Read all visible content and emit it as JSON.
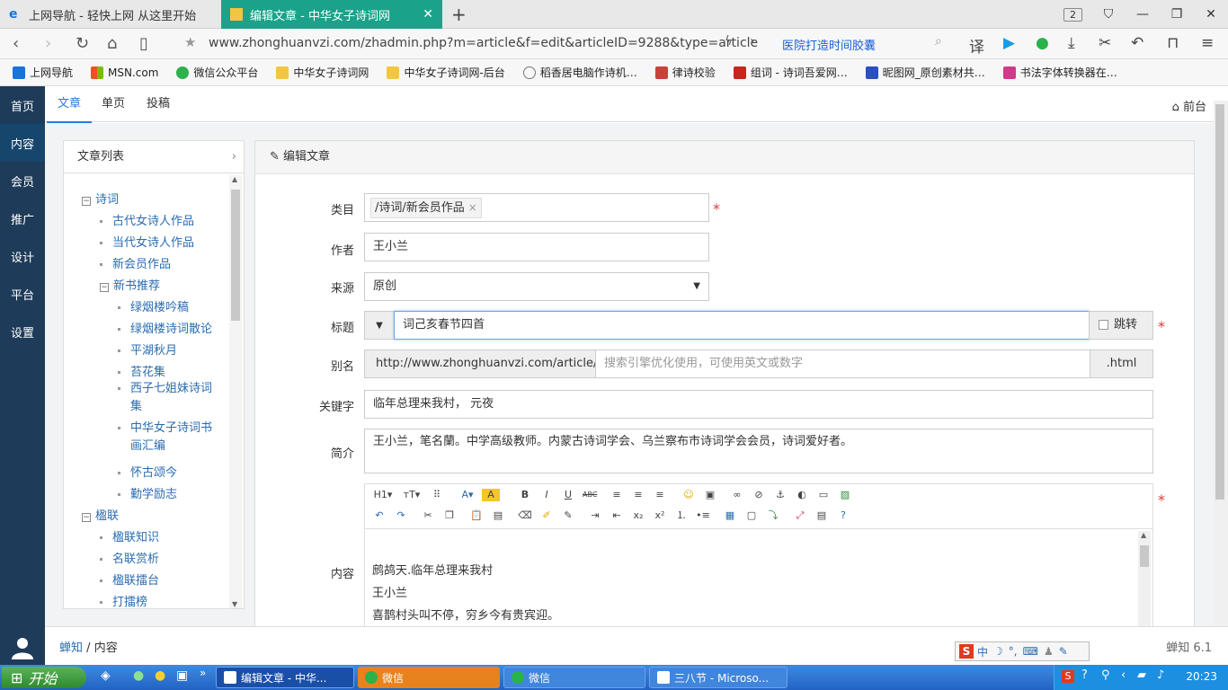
{
  "browser": {
    "tabs": [
      {
        "label": "上网导航 - 轻快上网 从这里开始",
        "active": false
      },
      {
        "label": "编辑文章 - 中华女子诗词网",
        "active": true
      }
    ],
    "tab_count": "2",
    "url": "www.zhonghuanvzi.com/zhadmin.php?m=article&f=edit&articleID=9288&type=article",
    "ad_text": "医院打造时间胶囊",
    "bookmarks": [
      "上网导航",
      "MSN.com",
      "微信公众平台",
      "中华女子诗词网",
      "中华女子诗词网-后台",
      "稻香居电脑作诗机…",
      "律诗校验",
      "组词 - 诗词吾爱网…",
      "昵图网_原创素材共…",
      "书法字体转换器在…"
    ]
  },
  "leftnav": [
    "首页",
    "内容",
    "会员",
    "推广",
    "设计",
    "平台",
    "设置"
  ],
  "topnav": {
    "items": [
      "文章",
      "单页",
      "投稿"
    ],
    "front": "前台"
  },
  "list": {
    "title": "文章列表",
    "tree": [
      {
        "label": "诗词",
        "level": 0,
        "type": "toggle"
      },
      {
        "label": "古代女诗人作品",
        "level": 1,
        "type": "dot"
      },
      {
        "label": "当代女诗人作品",
        "level": 1,
        "type": "dot"
      },
      {
        "label": "新会员作品",
        "level": 1,
        "type": "dot"
      },
      {
        "label": "新书推荐",
        "level": 1,
        "type": "toggle"
      },
      {
        "label": "绿烟楼吟稿",
        "level": 2,
        "type": "dot"
      },
      {
        "label": "绿烟楼诗词散论",
        "level": 2,
        "type": "dot"
      },
      {
        "label": "平湖秋月",
        "level": 2,
        "type": "dot"
      },
      {
        "label": "苔花集",
        "level": 2,
        "type": "dot"
      },
      {
        "label": "西子七姐妹诗词",
        "label2": "集",
        "level": 2,
        "type": "dot"
      },
      {
        "label": "中华女子诗词书",
        "label2": "画汇编",
        "level": 2,
        "type": "dot"
      },
      {
        "label": "怀古颂今",
        "level": 2,
        "type": "dot"
      },
      {
        "label": "勤学励志",
        "level": 2,
        "type": "dot"
      },
      {
        "label": "楹联",
        "level": 0,
        "type": "toggle"
      },
      {
        "label": "楹联知识",
        "level": 1,
        "type": "dot"
      },
      {
        "label": "名联赏析",
        "level": 1,
        "type": "dot"
      },
      {
        "label": "楹联擂台",
        "level": 1,
        "type": "dot"
      },
      {
        "label": "打擂榜",
        "level": 1,
        "type": "dot"
      }
    ]
  },
  "editor": {
    "title": "编辑文章",
    "category": {
      "label": "类目",
      "value": "/诗词/新会员作品"
    },
    "author": {
      "label": "作者",
      "value": "王小兰"
    },
    "source": {
      "label": "来源",
      "value": "原创"
    },
    "title_field": {
      "label": "标题",
      "value": "词己亥春节四首",
      "jump": "跳转"
    },
    "alias": {
      "label": "别名",
      "prefix": "http://www.zhonghuanvzi.com/article/id_",
      "placeholder": "搜索引擎优化使用，可使用英文或数字",
      "suffix": ".html"
    },
    "keywords": {
      "label": "关键字",
      "value": "临年总理来我村， 元夜"
    },
    "summary": {
      "label": "简介",
      "value": "王小兰，笔名蘭。中学高级教师。内蒙古诗词学会、乌兰察布市诗词学会会员，诗词爱好者。"
    },
    "content": {
      "label": "内容",
      "lines": [
        "鹧鸪天.临年总理来我村",
        "王小兰",
        "喜鹊村头叫不停，穷乡今有贵宾迎。"
      ]
    }
  },
  "footer": {
    "breadcrumb_root": "蝉知",
    "breadcrumb_sep": "/",
    "breadcrumb_current": "内容",
    "version": "蝉知 6.1"
  },
  "taskbar": {
    "start": "开始",
    "tasks": [
      "编辑文章 - 中华...",
      "微信",
      "微信",
      "三八节 - Microso..."
    ],
    "clock": "20:23"
  }
}
